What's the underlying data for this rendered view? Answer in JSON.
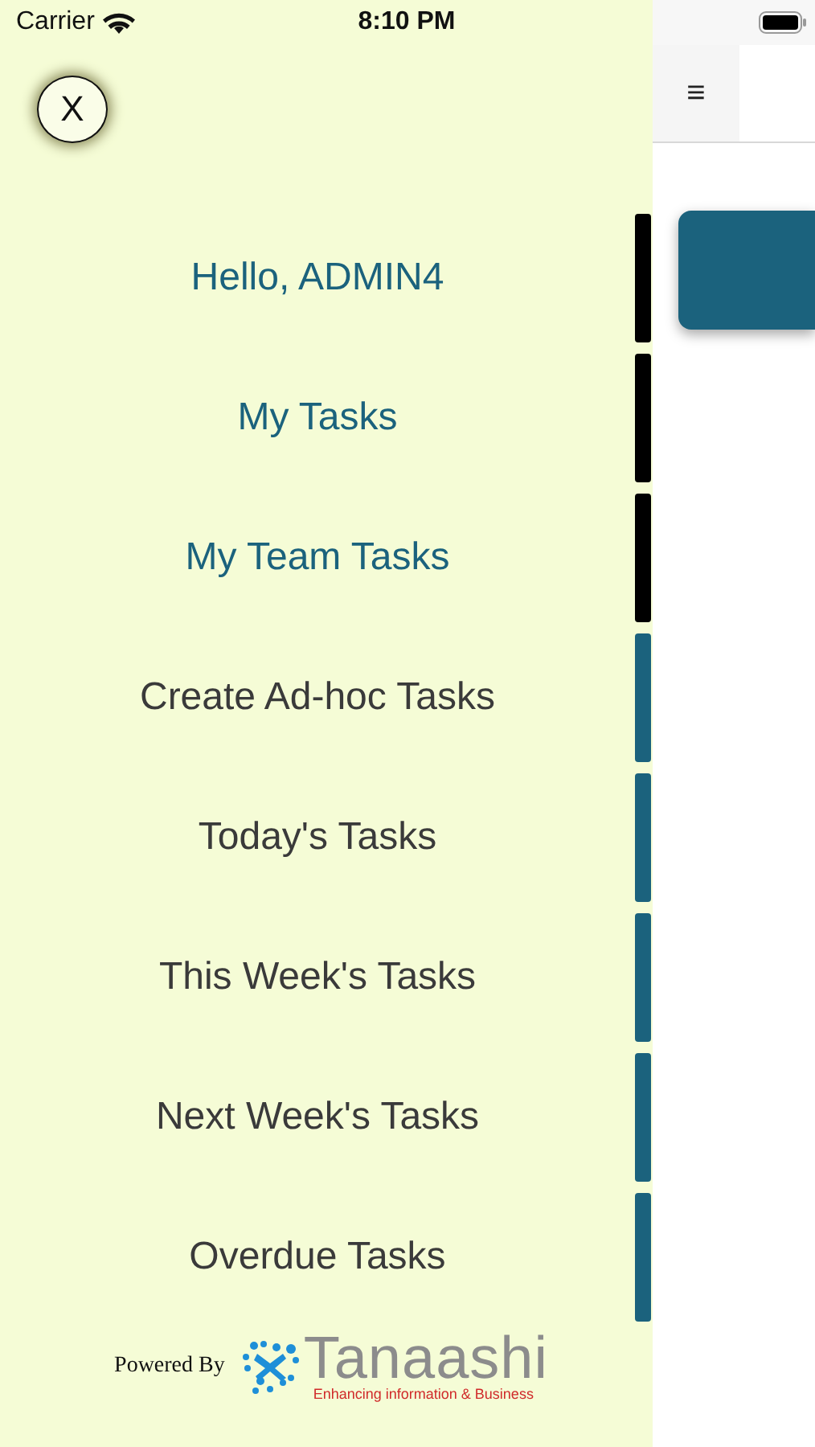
{
  "status_bar": {
    "carrier": "Carrier",
    "time": "8:10 PM"
  },
  "drawer": {
    "close_label": "X",
    "items": [
      {
        "label": "Hello, ADMIN4",
        "emphasized": true
      },
      {
        "label": "My Tasks",
        "emphasized": true
      },
      {
        "label": "My Team Tasks",
        "emphasized": true
      },
      {
        "label": "Create Ad-hoc Tasks",
        "emphasized": false
      },
      {
        "label": "Today's Tasks",
        "emphasized": false
      },
      {
        "label": "This Week's Tasks",
        "emphasized": false
      },
      {
        "label": "Next Week's Tasks",
        "emphasized": false
      },
      {
        "label": "Overdue Tasks",
        "emphasized": false
      }
    ],
    "footer": {
      "powered_by": "Powered By",
      "brand": "Tanaashi",
      "tagline": "Enhancing information & Business"
    }
  },
  "main": {
    "menu_icon": "≡"
  }
}
